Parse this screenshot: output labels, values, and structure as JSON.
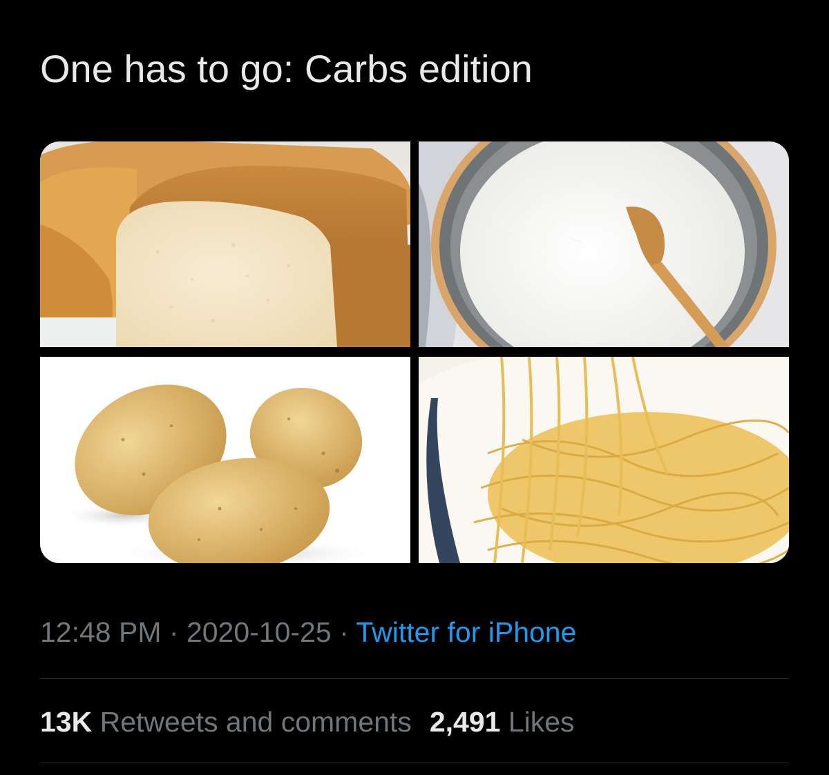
{
  "tweet": {
    "text": "One has to go: Carbs edition",
    "images": [
      {
        "name": "bread"
      },
      {
        "name": "rice"
      },
      {
        "name": "potatoes"
      },
      {
        "name": "spaghetti"
      }
    ]
  },
  "meta": {
    "time": "12:48 PM",
    "separator": " · ",
    "date": "2020-10-25",
    "source": "Twitter for iPhone"
  },
  "stats": {
    "retweets_count": "13K",
    "retweets_label": "Retweets and comments",
    "likes_count": "2,491",
    "likes_label": "Likes"
  },
  "colors": {
    "background": "#000000",
    "text_primary": "#e7e9ea",
    "text_secondary": "#71767b",
    "link": "#1d9bf0",
    "divider": "#2f3336"
  }
}
